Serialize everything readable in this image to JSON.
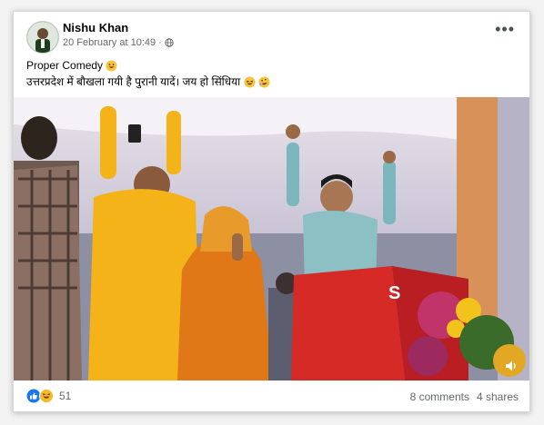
{
  "post": {
    "author": "Nishu Khan",
    "timestamp": "20 February at 10:49",
    "separator": "·",
    "privacy_icon": "globe-icon",
    "more_icon": "more-options-icon",
    "text_line1": "Proper Comedy",
    "text_line2": "उत्तरप्रदेश में बौखला गयी है पुरानी यादें। जय हो सिंधिया"
  },
  "media": {
    "type": "video",
    "volume_icon": "volume-icon"
  },
  "footer": {
    "reactions": [
      "like-reaction-icon",
      "haha-reaction-icon"
    ],
    "reaction_count": "51",
    "comments": "8 comments",
    "shares": "4 shares"
  },
  "colors": {
    "like_blue": "#1877f2",
    "haha_yellow": "#f7b928",
    "podium_red": "#d52a26",
    "kurta_yellow": "#f3b319",
    "saree_orange": "#e07818"
  }
}
